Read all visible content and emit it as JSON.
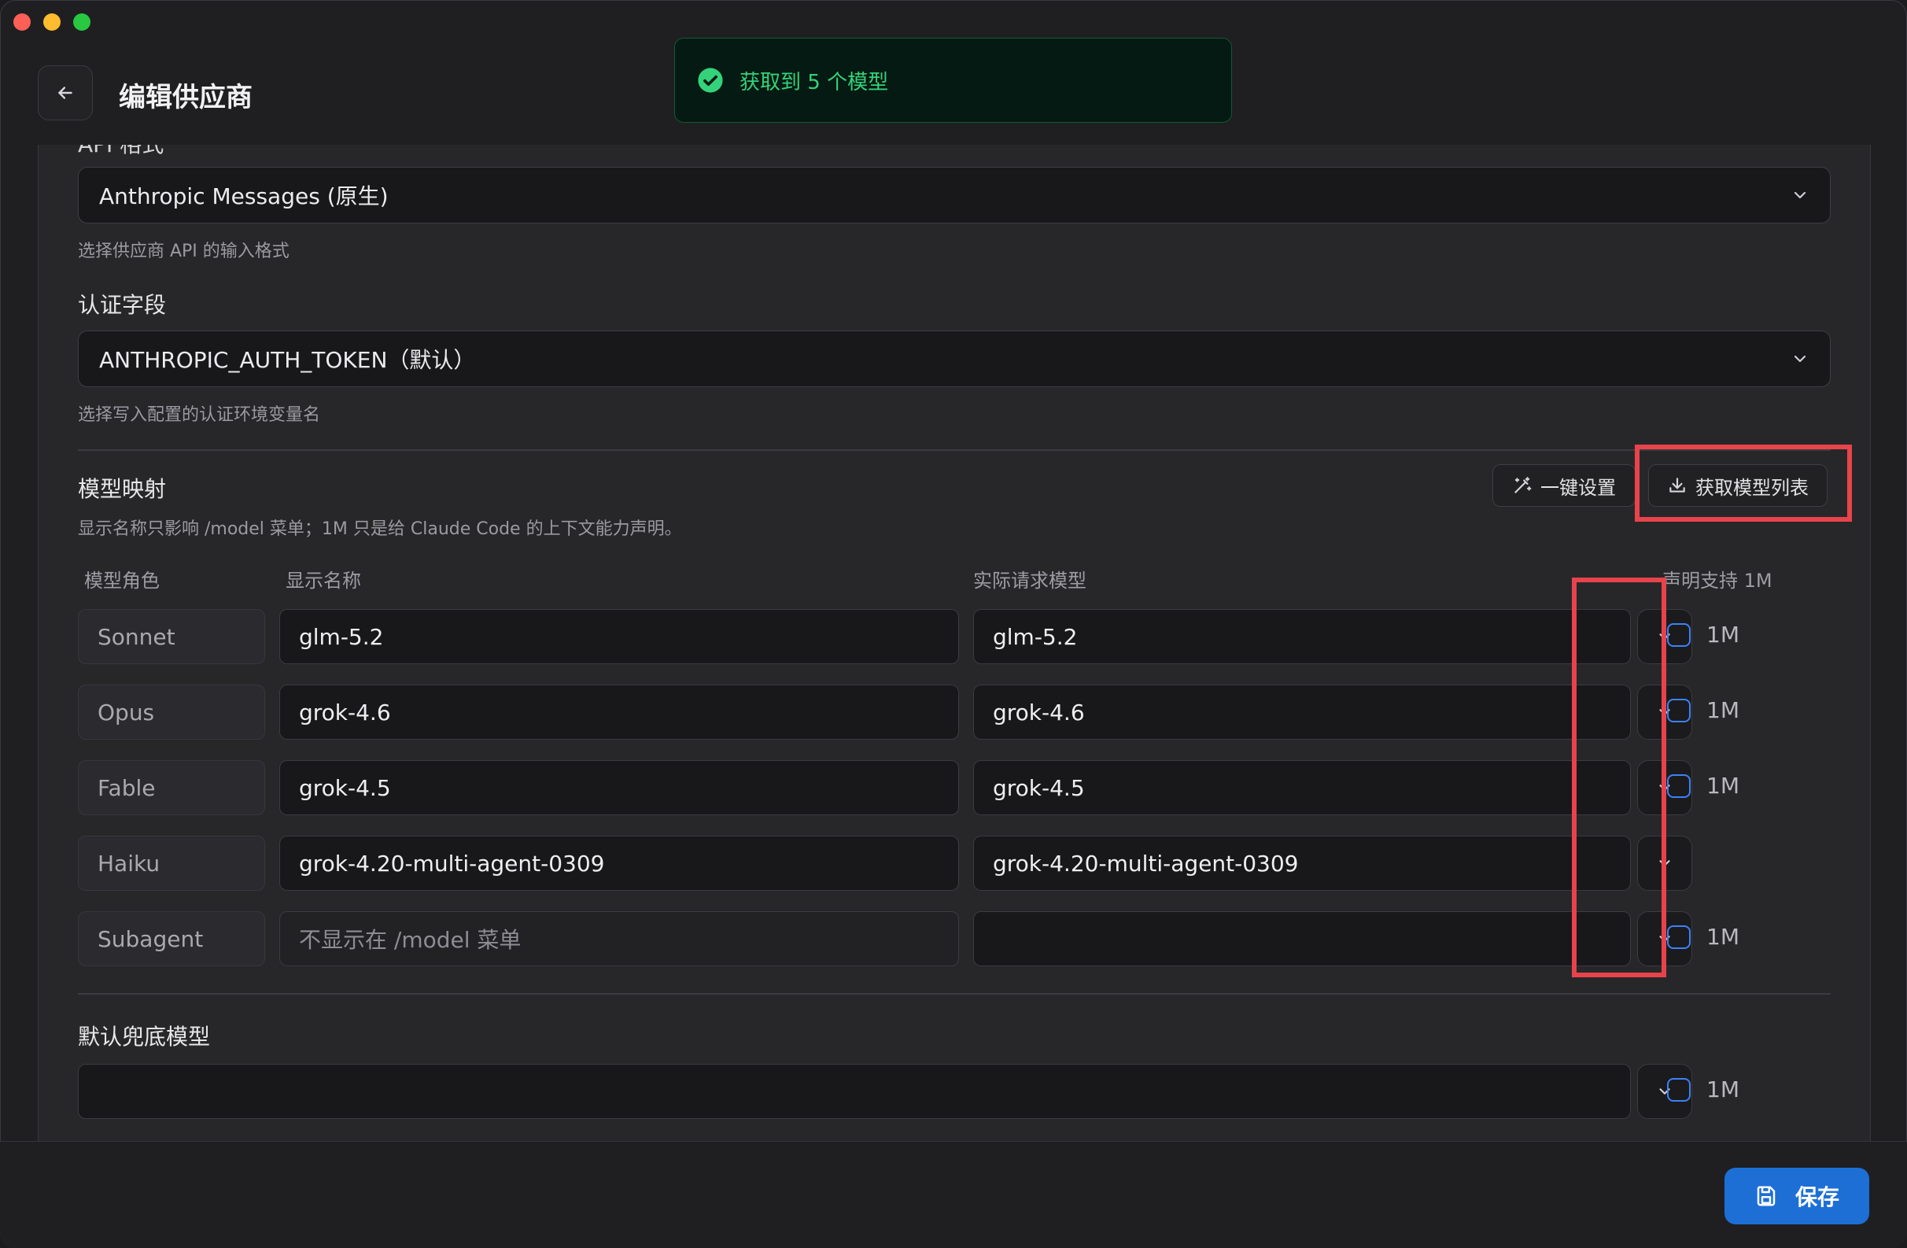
{
  "header": {
    "title": "编辑供应商"
  },
  "toast": {
    "message": "获取到 5 个模型"
  },
  "api_format": {
    "label": "API 格式",
    "value": "Anthropic Messages (原生)",
    "help": "选择供应商 API 的输入格式"
  },
  "auth_field": {
    "label": "认证字段",
    "value": "ANTHROPIC_AUTH_TOKEN（默认）",
    "help": "选择写入配置的认证环境变量名"
  },
  "model_mapping": {
    "title": "模型映射",
    "description": "显示名称只影响 /model 菜单；1M 只是给 Claude Code 的上下文能力声明。",
    "one_click_label": "一键设置",
    "fetch_label": "获取模型列表",
    "columns": {
      "role": "模型角色",
      "display": "显示名称",
      "actual": "实际请求模型",
      "declare": "声明支持 1M"
    },
    "rows": [
      {
        "role": "Sonnet",
        "display": "glm-5.2",
        "actual": "glm-5.2",
        "badge": "1M"
      },
      {
        "role": "Opus",
        "display": "grok-4.6",
        "actual": "grok-4.6",
        "badge": "1M"
      },
      {
        "role": "Fable",
        "display": "grok-4.5",
        "actual": "grok-4.5",
        "badge": "1M"
      },
      {
        "role": "Haiku",
        "display": "grok-4.20-multi-agent-0309",
        "actual": "grok-4.20-multi-agent-0309",
        "badge": ""
      },
      {
        "role": "Subagent",
        "display_placeholder": "不显示在 /model 菜单",
        "actual": "",
        "badge": "1M"
      }
    ]
  },
  "fallback": {
    "label": "默认兜底模型",
    "value": "",
    "badge": "1M"
  },
  "footer": {
    "save_label": "保存"
  }
}
